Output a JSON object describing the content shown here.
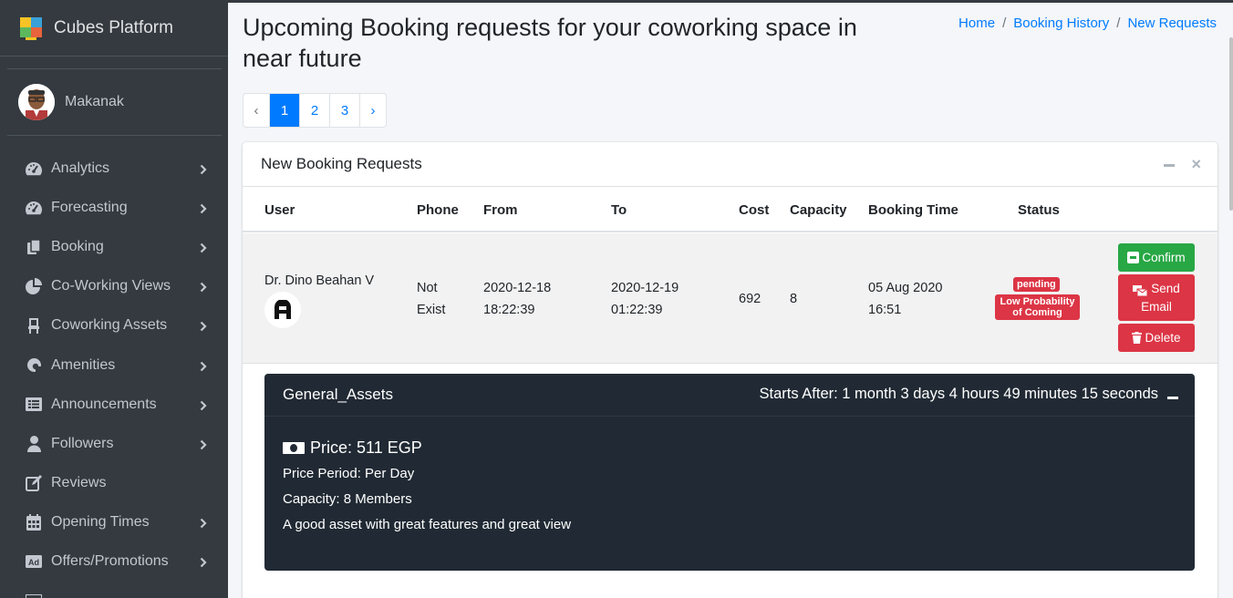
{
  "brand": {
    "name": "Cubes Platform"
  },
  "user": {
    "name": "Makanak"
  },
  "sidebar": {
    "items": [
      {
        "label": "Analytics",
        "icon": "tachometer-icon",
        "chevron": true
      },
      {
        "label": "Forecasting",
        "icon": "tachometer-icon",
        "chevron": true
      },
      {
        "label": "Booking",
        "icon": "copy-icon",
        "chevron": true
      },
      {
        "label": "Co-Working Views",
        "icon": "pie-chart-icon",
        "chevron": true
      },
      {
        "label": "Coworking Assets",
        "icon": "chair-icon",
        "chevron": true
      },
      {
        "label": "Amenities",
        "icon": "amenities-icon",
        "chevron": true
      },
      {
        "label": "Announcements",
        "icon": "list-alt-icon",
        "chevron": true
      },
      {
        "label": "Followers",
        "icon": "user-icon",
        "chevron": true
      },
      {
        "label": "Reviews",
        "icon": "edit-icon",
        "chevron": false
      },
      {
        "label": "Opening Times",
        "icon": "calendar-icon",
        "chevron": true
      },
      {
        "label": "Offers/Promotions",
        "icon": "ad-icon",
        "chevron": true
      }
    ]
  },
  "page": {
    "title": "Upcoming Booking requests for your coworking space in near future"
  },
  "breadcrumb": [
    "Home",
    "Booking History",
    "New Requests"
  ],
  "pagination": {
    "prev": "‹",
    "pages": [
      "1",
      "2",
      "3"
    ],
    "next": "›",
    "active": "1"
  },
  "card": {
    "title": "New Booking Requests",
    "columns": [
      "User",
      "Phone",
      "From",
      "To",
      "Cost",
      "Capacity",
      "Booking Time",
      "Status"
    ]
  },
  "booking": {
    "user": "Dr. Dino Beahan V",
    "phone_line1": "Not",
    "phone_line2": "Exist",
    "from_date": "2020-12-18",
    "from_time": "18:22:39",
    "to_date": "2020-12-19",
    "to_time": "01:22:39",
    "cost": "692",
    "capacity": "8",
    "booking_date": "05 Aug 2020",
    "booking_time": "16:51",
    "status": "pending",
    "probability_line1": "Low Probability",
    "probability_line2": "of Coming",
    "actions": {
      "confirm": "Confirm",
      "send_line1": "Send",
      "send_line2": "Email",
      "delete": "Delete"
    }
  },
  "asset": {
    "name": "General_Assets",
    "starts_after": "Starts After: 1 month 3 days 4 hours 49 minutes 15 seconds",
    "price": "Price: 511 EGP",
    "price_period": "Price Period: Per Day",
    "capacity": "Capacity: 8 Members",
    "description": "A good asset with great features and great view"
  },
  "colors": {
    "sidebar_bg": "#343a40",
    "primary": "#007bff",
    "success": "#28a745",
    "danger": "#dc3545",
    "asset_bg": "#212a34"
  }
}
